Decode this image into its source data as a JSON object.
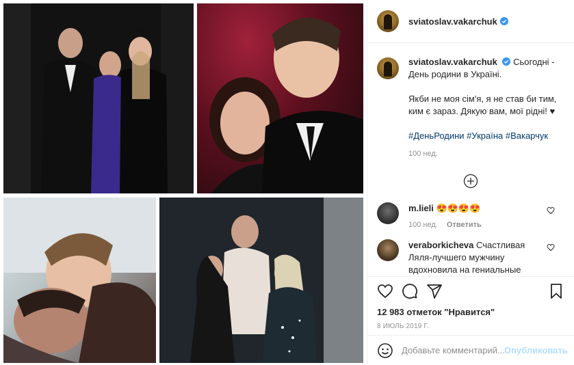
{
  "post": {
    "username": "sviatoslav.vakarchuk",
    "caption_line1": "Сьогодні - День родини в Україні.",
    "caption_para2": "Якби не моя сім'я, я не став би тим, ким є зараз. Дякую вам, мої рідні! ♥",
    "hashtags": "#ДеньРодини #Україна #Вакарчук",
    "caption_age": "100 нед."
  },
  "comments": [
    {
      "username": "m.lieli",
      "text": "😍😍😍😍",
      "age": "100 нед.",
      "reply_label": "Ответить"
    },
    {
      "username": "veraborkicheva",
      "text": "Счастливая Ляля-лучшего мужчину вдохновила на гениальные"
    }
  ],
  "stats": {
    "likes": "12 983 отметок \"Нравится\"",
    "date": "8 ИЮЛЬ 2019 Г."
  },
  "add_comment": {
    "placeholder": "Добавьте комментарий...",
    "publish_label": "Опубликовать"
  },
  "colors": {
    "hashtag": "#00376b",
    "publish_disabled": "#b2dffc",
    "verified": "#3897f0",
    "meta": "#8e8e8e"
  },
  "icons": [
    "verified-icon",
    "add-circle-icon",
    "heart-icon",
    "comment-icon",
    "share-icon",
    "bookmark-icon",
    "emoji-icon"
  ]
}
